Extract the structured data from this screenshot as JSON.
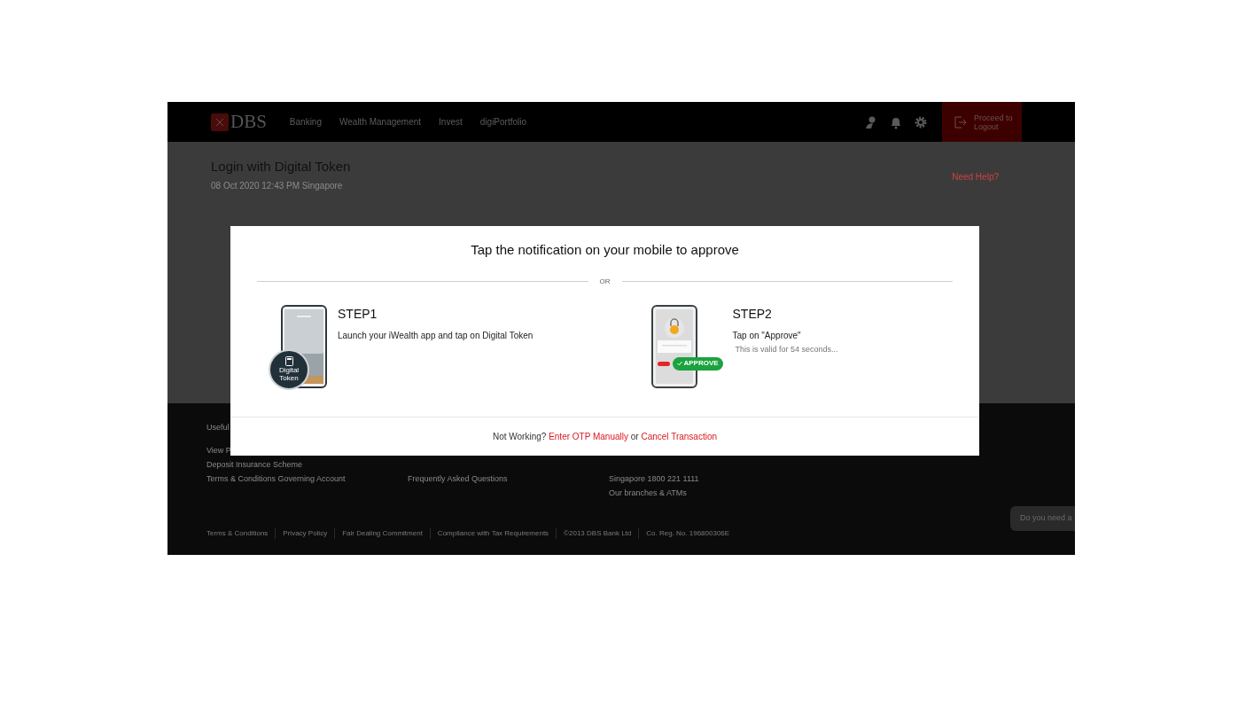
{
  "nav": {
    "logo_text": "DBS",
    "links": [
      {
        "label": "Banking"
      },
      {
        "label": "Wealth Management"
      },
      {
        "label": "Invest"
      },
      {
        "label": "digiPortfolio"
      }
    ],
    "logout": "Proceed to Logout"
  },
  "page": {
    "title": "Login with Digital Token",
    "timestamp": "08 Oct 2020 12:43 PM Singapore",
    "help_link": "Need Help?"
  },
  "modal": {
    "title": "Tap the notification on your mobile to approve",
    "separator": "OR",
    "steps": [
      {
        "kind": "token",
        "heading": "STEP1",
        "text": "Launch your iWealth app and tap on Digital Token",
        "badge_label": "Digital Token"
      },
      {
        "kind": "approve",
        "heading": "STEP2",
        "text": "Tap on \"Approve\"",
        "note": "This is valid for 54 seconds...",
        "approve_label": "APPROVE"
      }
    ],
    "footer": {
      "lead": "Not Working?",
      "otp_link": "Enter OTP Manually",
      "joiner": "or",
      "cancel_link": "Cancel Transaction"
    }
  },
  "footer": {
    "columns": [
      {
        "heading": "Useful",
        "links": [
          "View P",
          "Deposit Insurance Scheme",
          "Terms & Conditions Governing Account"
        ]
      },
      {
        "links": [
          "Frequently Asked Questions"
        ]
      },
      {
        "links": [
          "Singapore 1800 221 1111",
          "Our branches & ATMs"
        ]
      }
    ],
    "legal_links": [
      "Terms & Conditions",
      "Privacy Policy",
      "Fair Dealing Commitment",
      "Compliance with Tax Requirements",
      "©2013 DBS Bank Ltd",
      "Co. Reg. No. 196800306E"
    ]
  },
  "chat": {
    "text": "Do you need a"
  }
}
